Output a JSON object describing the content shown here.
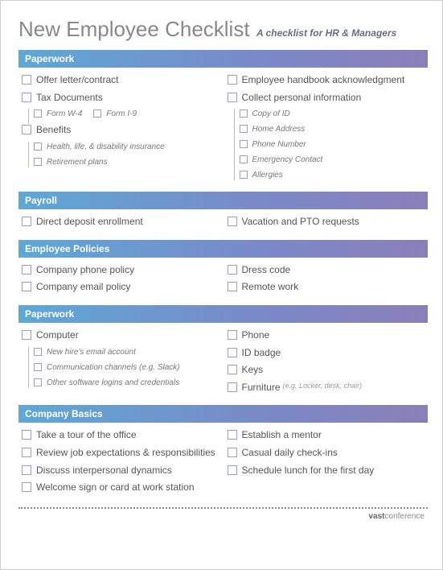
{
  "header": {
    "title": "New Employee Checklist",
    "subtitle": "A checklist for HR & Managers"
  },
  "sections": {
    "paperwork1": {
      "title": "Paperwork",
      "left": {
        "offer": "Offer letter/contract",
        "tax": "Tax Documents",
        "w4": "Form W-4",
        "i9": "Form I-9",
        "benefits": "Benefits",
        "health": "Health, life, & disability insurance",
        "retire": "Retirement plans"
      },
      "right": {
        "handbook": "Employee handbook acknowledgment",
        "collect": "Collect personal information",
        "copyid": "Copy of ID",
        "homeaddr": "Home Address",
        "phone": "Phone Number",
        "emerg": "Emergency Contact",
        "allerg": "Allergies"
      }
    },
    "payroll": {
      "title": "Payroll",
      "left": {
        "dd": "Direct deposit enrollment"
      },
      "right": {
        "pto": "Vacation and PTO requests"
      }
    },
    "policies": {
      "title": "Employee Policies",
      "left": {
        "phone": "Company phone policy",
        "email": "Company email policy"
      },
      "right": {
        "dress": "Dress code",
        "remote": "Remote work"
      }
    },
    "paperwork2": {
      "title": "Paperwork",
      "left": {
        "computer": "Computer",
        "emailacct": "New hire's email account",
        "comm": "Communication channels (e.g. Slack)",
        "other": "Other software logins and credentials"
      },
      "right": {
        "phone": "Phone",
        "idbadge": "ID badge",
        "keys": "Keys",
        "furniture": "Furniture",
        "furniture_note": "(e.g. Locker, desk, chair)"
      }
    },
    "basics": {
      "title": "Company Basics",
      "left": {
        "tour": "Take a tour of the office",
        "review": "Review job expectations & responsibilities",
        "discuss": "Discuss interpersonal dynamics",
        "welcome": "Welcome sign or card at work station"
      },
      "right": {
        "mentor": "Establish a mentor",
        "checkins": "Casual daily check-ins",
        "lunch": "Schedule lunch for the first day"
      }
    }
  },
  "footer": {
    "brand1": "vast",
    "brand2": "conference"
  }
}
